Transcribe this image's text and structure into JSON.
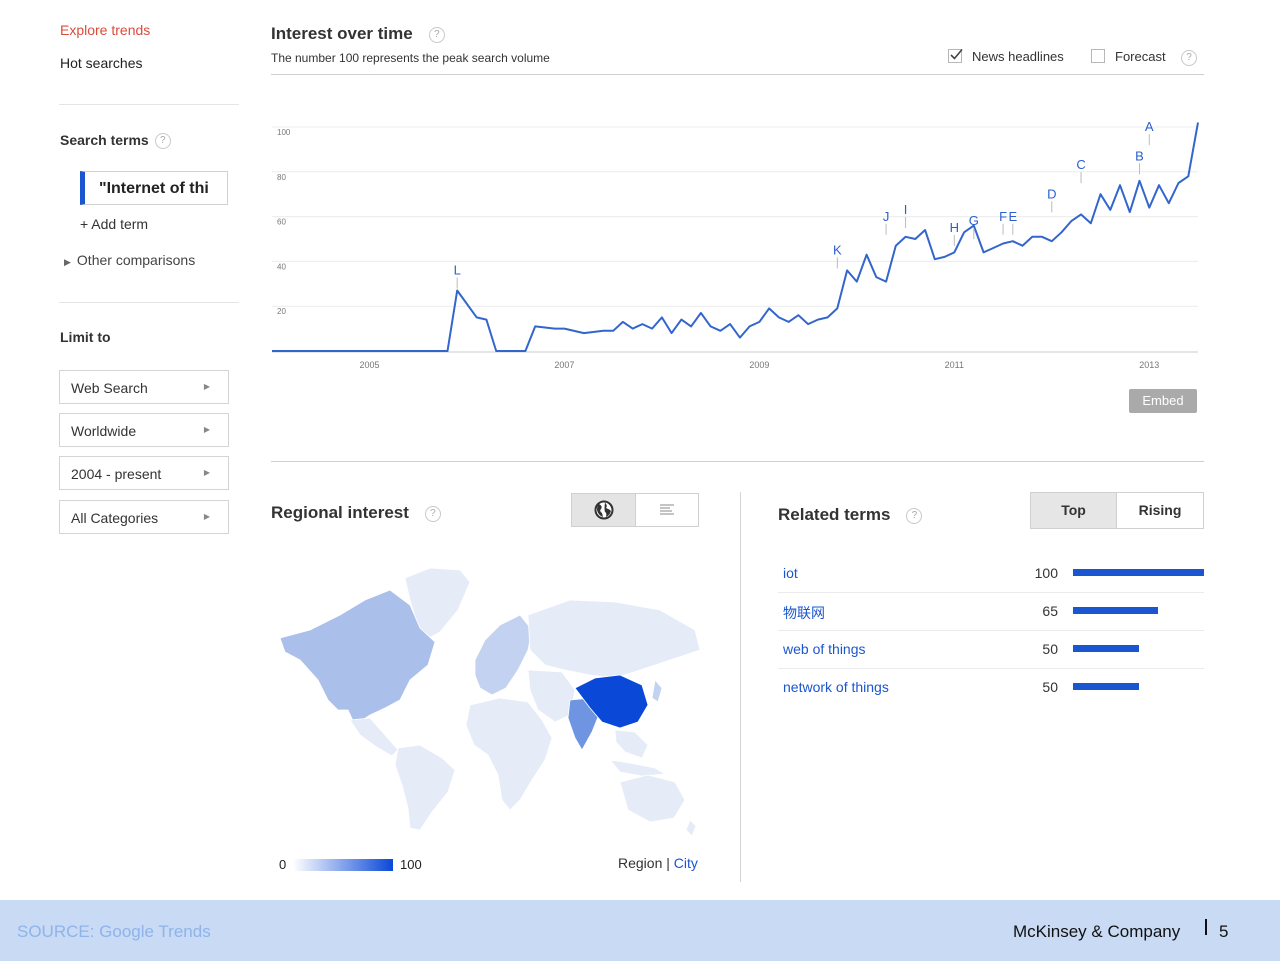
{
  "sidebar": {
    "explore_trends": "Explore trends",
    "hot_searches": "Hot searches",
    "search_terms_label": "Search terms",
    "term": "\"Internet of thi",
    "add_term": "+ Add term",
    "other_comparisons": "Other comparisons",
    "limit_to": "Limit to",
    "filters": [
      "Web Search",
      "Worldwide",
      "2004 - present",
      "All Categories"
    ]
  },
  "interest": {
    "title": "Interest over time",
    "subtitle": "The number 100 represents the peak search volume",
    "news_headlines": "News headlines",
    "news_checked": true,
    "forecast": "Forecast",
    "forecast_checked": false,
    "embed": "Embed"
  },
  "chart_data": {
    "type": "line",
    "series": [
      {
        "color": "#3366cc",
        "x": [
          2004.0,
          2005.8,
          2005.9,
          2006.1,
          2006.2,
          2006.3,
          2006.4,
          2006.6,
          2006.7,
          2006.9,
          2007.0,
          2007.2,
          2007.4,
          2007.5,
          2007.6,
          2007.7,
          2007.8,
          2007.9,
          2008.0,
          2008.1,
          2008.2,
          2008.3,
          2008.4,
          2008.5,
          2008.6,
          2008.7,
          2008.8,
          2008.9,
          2009.0,
          2009.1,
          2009.2,
          2009.3,
          2009.4,
          2009.5,
          2009.6,
          2009.7,
          2009.8,
          2009.9,
          2010.0,
          2010.1,
          2010.2,
          2010.3,
          2010.4,
          2010.5,
          2010.6,
          2010.7,
          2010.8,
          2010.9,
          2011.0,
          2011.1,
          2011.2,
          2011.3,
          2011.4,
          2011.5,
          2011.6,
          2011.7,
          2011.8,
          2011.9,
          2012.0,
          2012.1,
          2012.2,
          2012.3,
          2012.4,
          2012.5,
          2012.6,
          2012.7,
          2012.8,
          2012.9,
          2013.0,
          2013.1,
          2013.2,
          2013.3,
          2013.4,
          2013.5
        ],
        "values": [
          0,
          0,
          27,
          15,
          14,
          0,
          0,
          0,
          11,
          10,
          10,
          8,
          9,
          9,
          13,
          10,
          12,
          10,
          15,
          8,
          14,
          11,
          17,
          11,
          9,
          12,
          6,
          11,
          13,
          19,
          15,
          13,
          16,
          12,
          14,
          15,
          19,
          36,
          31,
          43,
          33,
          31,
          47,
          51,
          50,
          54,
          41,
          42,
          44,
          53,
          56,
          44,
          46,
          48,
          49,
          47,
          51,
          51,
          49,
          53,
          58,
          61,
          57,
          70,
          63,
          74,
          62,
          76,
          64,
          74,
          66,
          75,
          78,
          102
        ]
      }
    ],
    "x_ticks": [
      "2005",
      "2007",
      "2009",
      "2011",
      "2013"
    ],
    "x_tick_values": [
      2005,
      2007,
      2009,
      2011,
      2013
    ],
    "y_ticks": [
      20,
      40,
      60,
      80,
      100
    ],
    "ylim": [
      0,
      100
    ],
    "xlim": [
      2004.0,
      2013.5
    ],
    "grid": true,
    "annotations": [
      {
        "label": "L",
        "x": 2005.9,
        "y": 27
      },
      {
        "label": "K",
        "x": 2009.8,
        "y": 36
      },
      {
        "label": "J",
        "x": 2010.3,
        "y": 51
      },
      {
        "label": "I",
        "x": 2010.5,
        "y": 54
      },
      {
        "label": "H",
        "x": 2011.0,
        "y": 46
      },
      {
        "label": "G",
        "x": 2011.2,
        "y": 49
      },
      {
        "label": "F",
        "x": 2011.5,
        "y": 51
      },
      {
        "label": "E",
        "x": 2011.6,
        "y": 51
      },
      {
        "label": "D",
        "x": 2012.0,
        "y": 61
      },
      {
        "label": "C",
        "x": 2012.3,
        "y": 74
      },
      {
        "label": "B",
        "x": 2012.9,
        "y": 78
      },
      {
        "label": "A",
        "x": 2013.0,
        "y": 91
      }
    ]
  },
  "regional": {
    "title": "Regional interest",
    "legend_min": "0",
    "legend_max": "100",
    "region_label": "Region",
    "separator": "|",
    "city_label": "City",
    "low_color": "#e8edf8",
    "mid_color": "#aabfea",
    "high_color": "#0a48d8"
  },
  "related": {
    "title": "Related terms",
    "tab_top": "Top",
    "tab_rising": "Rising",
    "rows": [
      {
        "term": "iot",
        "value": 100
      },
      {
        "term": "物联网",
        "value": 65
      },
      {
        "term": "web of things",
        "value": 50
      },
      {
        "term": "network of things",
        "value": 50
      }
    ]
  },
  "footer": {
    "source": "SOURCE: Google Trends",
    "brand": "McKinsey & Company",
    "page": "5"
  }
}
